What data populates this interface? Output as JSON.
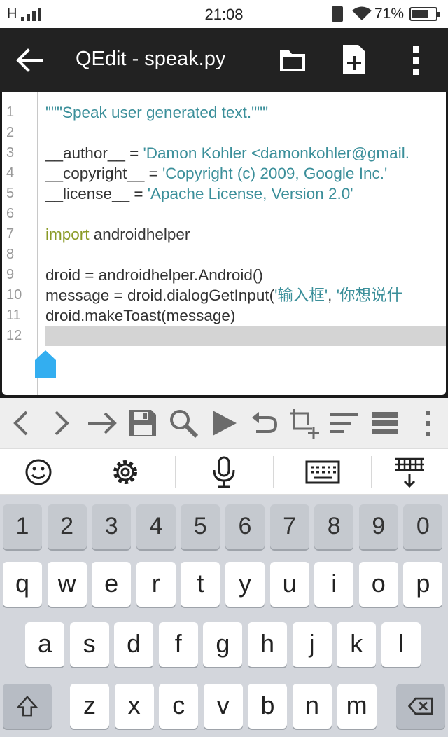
{
  "status_bar": {
    "signal_label": "H",
    "time": "21:08",
    "battery_percent": "71%",
    "battery_level": 0.71
  },
  "app_bar": {
    "title": "QEdit - speak.py",
    "icons": [
      "back-arrow-icon",
      "folder-icon",
      "new-file-icon",
      "overflow-menu-icon"
    ]
  },
  "editor": {
    "lines": [
      {
        "num": "1",
        "parts": [
          {
            "t": "\"\"\"Speak user generated text.\"\"\"",
            "c": "str"
          }
        ]
      },
      {
        "num": "2",
        "parts": []
      },
      {
        "num": "3",
        "parts": [
          {
            "t": "__author__ = ",
            "c": "plain"
          },
          {
            "t": "'Damon Kohler <damonkohler@gmail.",
            "c": "str"
          }
        ]
      },
      {
        "num": "4",
        "parts": [
          {
            "t": "__copyright__ = ",
            "c": "plain"
          },
          {
            "t": "'Copyright (c) 2009, Google Inc.'",
            "c": "str"
          }
        ]
      },
      {
        "num": "5",
        "parts": [
          {
            "t": "__license__ = ",
            "c": "plain"
          },
          {
            "t": "'Apache License, Version 2.0'",
            "c": "str"
          }
        ]
      },
      {
        "num": "6",
        "parts": []
      },
      {
        "num": "7",
        "parts": [
          {
            "t": "import",
            "c": "kw"
          },
          {
            "t": " androidhelper",
            "c": "plain"
          }
        ]
      },
      {
        "num": "8",
        "parts": []
      },
      {
        "num": "9",
        "parts": [
          {
            "t": "droid = androidhelper.Android()",
            "c": "plain"
          }
        ]
      },
      {
        "num": "10",
        "parts": [
          {
            "t": "message = droid.dialogGetInput(",
            "c": "plain"
          },
          {
            "t": "'输入框'",
            "c": "str"
          },
          {
            "t": ", ",
            "c": "plain"
          },
          {
            "t": "'你想说什",
            "c": "str"
          }
        ]
      },
      {
        "num": "11",
        "parts": [
          {
            "t": "droid.makeToast(message)",
            "c": "plain"
          }
        ]
      },
      {
        "num": "12",
        "parts": [],
        "current": true
      }
    ]
  },
  "toolbar": {
    "icons": [
      "chevron-left-icon",
      "chevron-right-icon",
      "arrow-right-icon",
      "save-icon",
      "search-icon",
      "run-icon",
      "undo-icon",
      "crop-add-icon",
      "format-align-icon",
      "list-icon",
      "more-vert-icon"
    ]
  },
  "keyboard_bar": {
    "icons": [
      "emoji-icon",
      "settings-gear-icon",
      "microphone-icon",
      "keyboard-icon",
      "hide-keyboard-icon"
    ]
  },
  "keyboard": {
    "row_numbers": [
      "1",
      "2",
      "3",
      "4",
      "5",
      "6",
      "7",
      "8",
      "9",
      "0"
    ],
    "row1": [
      "q",
      "w",
      "e",
      "r",
      "t",
      "y",
      "u",
      "i",
      "o",
      "p"
    ],
    "row2": [
      "a",
      "s",
      "d",
      "f",
      "g",
      "h",
      "j",
      "k",
      "l"
    ],
    "row3": [
      "z",
      "x",
      "c",
      "v",
      "b",
      "n",
      "m"
    ]
  }
}
